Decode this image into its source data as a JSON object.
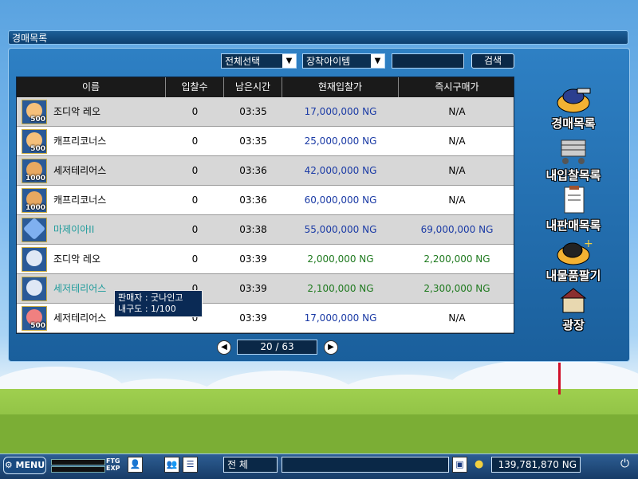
{
  "window": {
    "title": "경매목록"
  },
  "filters": {
    "category": "전체선택",
    "subcategory": "장착아이템",
    "search_value": "",
    "search_button": "검색"
  },
  "table": {
    "headers": [
      "이름",
      "입찰수",
      "남은시간",
      "현재입찰가",
      "즉시구매가"
    ],
    "rows": [
      {
        "name": "조디악 레오",
        "bids": "0",
        "time": "03:35",
        "current": "17,000,000 NG",
        "buyout": "N/A",
        "qty": "500"
      },
      {
        "name": "캐프리코너스",
        "bids": "0",
        "time": "03:35",
        "current": "25,000,000 NG",
        "buyout": "N/A",
        "qty": "500"
      },
      {
        "name": "세저테리어스",
        "bids": "0",
        "time": "03:36",
        "current": "42,000,000 NG",
        "buyout": "N/A",
        "qty": "1000"
      },
      {
        "name": "캐프리코너스",
        "bids": "0",
        "time": "03:36",
        "current": "60,000,000 NG",
        "buyout": "N/A",
        "qty": "1000"
      },
      {
        "name": "마제이아II",
        "bids": "0",
        "time": "03:38",
        "current": "55,000,000 NG",
        "buyout": "69,000,000 NG",
        "qty": ""
      },
      {
        "name": "조디악 레오",
        "bids": "0",
        "time": "03:39",
        "current": "2,000,000 NG",
        "buyout": "2,200,000 NG",
        "qty": ""
      },
      {
        "name": "세저테리어스",
        "bids": "0",
        "time": "03:39",
        "current": "2,100,000 NG",
        "buyout": "2,300,000 NG",
        "qty": ""
      },
      {
        "name": "세저테리어스",
        "bids": "0",
        "time": "03:39",
        "current": "17,000,000 NG",
        "buyout": "N/A",
        "qty": "500"
      }
    ]
  },
  "tooltip": {
    "seller": "판매자 : 굿나인고",
    "durability": "내구도 : 1/100"
  },
  "pager": {
    "text": "20 / 63"
  },
  "side_menu": [
    "경매목록",
    "내입찰목록",
    "내판매목록",
    "내물품팔기",
    "광장"
  ],
  "bottom": {
    "menu": "MENU",
    "ftg": "FTG",
    "exp": "EXP",
    "chat_channel": "전   체",
    "money": "139,781,870 NG"
  },
  "colors": {
    "accent": "#1a5f9c",
    "price_blue": "#1a3aa5",
    "price_green": "#1f7a1f",
    "name_teal": "#209c9c"
  }
}
